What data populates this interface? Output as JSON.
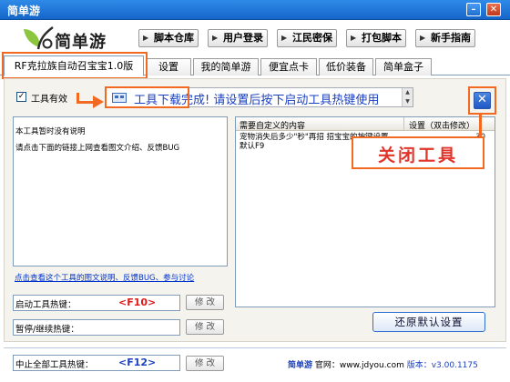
{
  "window": {
    "title": "简单游",
    "minimize_label": "–",
    "close_label": "✕"
  },
  "header": {
    "logo_text": "简单游",
    "nav_buttons": [
      "脚本仓库",
      "用户登录",
      "江民密保",
      "打包脚本",
      "新手指南"
    ]
  },
  "tabs": [
    "RF克拉族自动召宝宝1.0版",
    "设置",
    "我的简单游",
    "便宜点卡",
    "低价装备",
    "简单盒子"
  ],
  "tool": {
    "enabled_label": "工具有效",
    "enabled_checked": true,
    "checkbox_mark": "✓",
    "status_text": "工具下载完成! 请设置后按下启动工具热键使用",
    "description_lines": [
      "本工具暂时没有说明",
      "请点击下面的链接上网查看图文介绍、反馈BUG"
    ],
    "help_link": "点击查看这个工具的图文说明、反馈BUG、参与讨论",
    "close_button": "✕"
  },
  "settings_grid": {
    "columns": [
      "需要自定义的内容",
      "设置（双击修改）"
    ],
    "rows": [
      {
        "content": "宠物消失后多少\"秒\"再招 招宝宝的按键设置，默认F9",
        "value": "30"
      }
    ]
  },
  "hotkeys": [
    {
      "label": "启动工具热键：",
      "key": "<F10>",
      "edit": "修 改"
    },
    {
      "label": "暂停/继续热键：",
      "key": "",
      "edit": "修 改"
    },
    {
      "label": "中止全部工具热键：",
      "key": "<F12>",
      "edit": "修 改"
    }
  ],
  "restore_defaults_label": "还原默认设置",
  "annotation": {
    "callout_text": "关闭工具"
  },
  "footer": {
    "brand": "简单游",
    "site_label": "官网：www.jdyou.com",
    "version_label": "版本：v3.00.1175"
  },
  "colors": {
    "titlebar": "#1c6fd4",
    "annotation_orange": "#f26a22",
    "hotkey_red": "#e01818",
    "link_blue": "#0033cc",
    "callout_red": "#e1352b"
  }
}
